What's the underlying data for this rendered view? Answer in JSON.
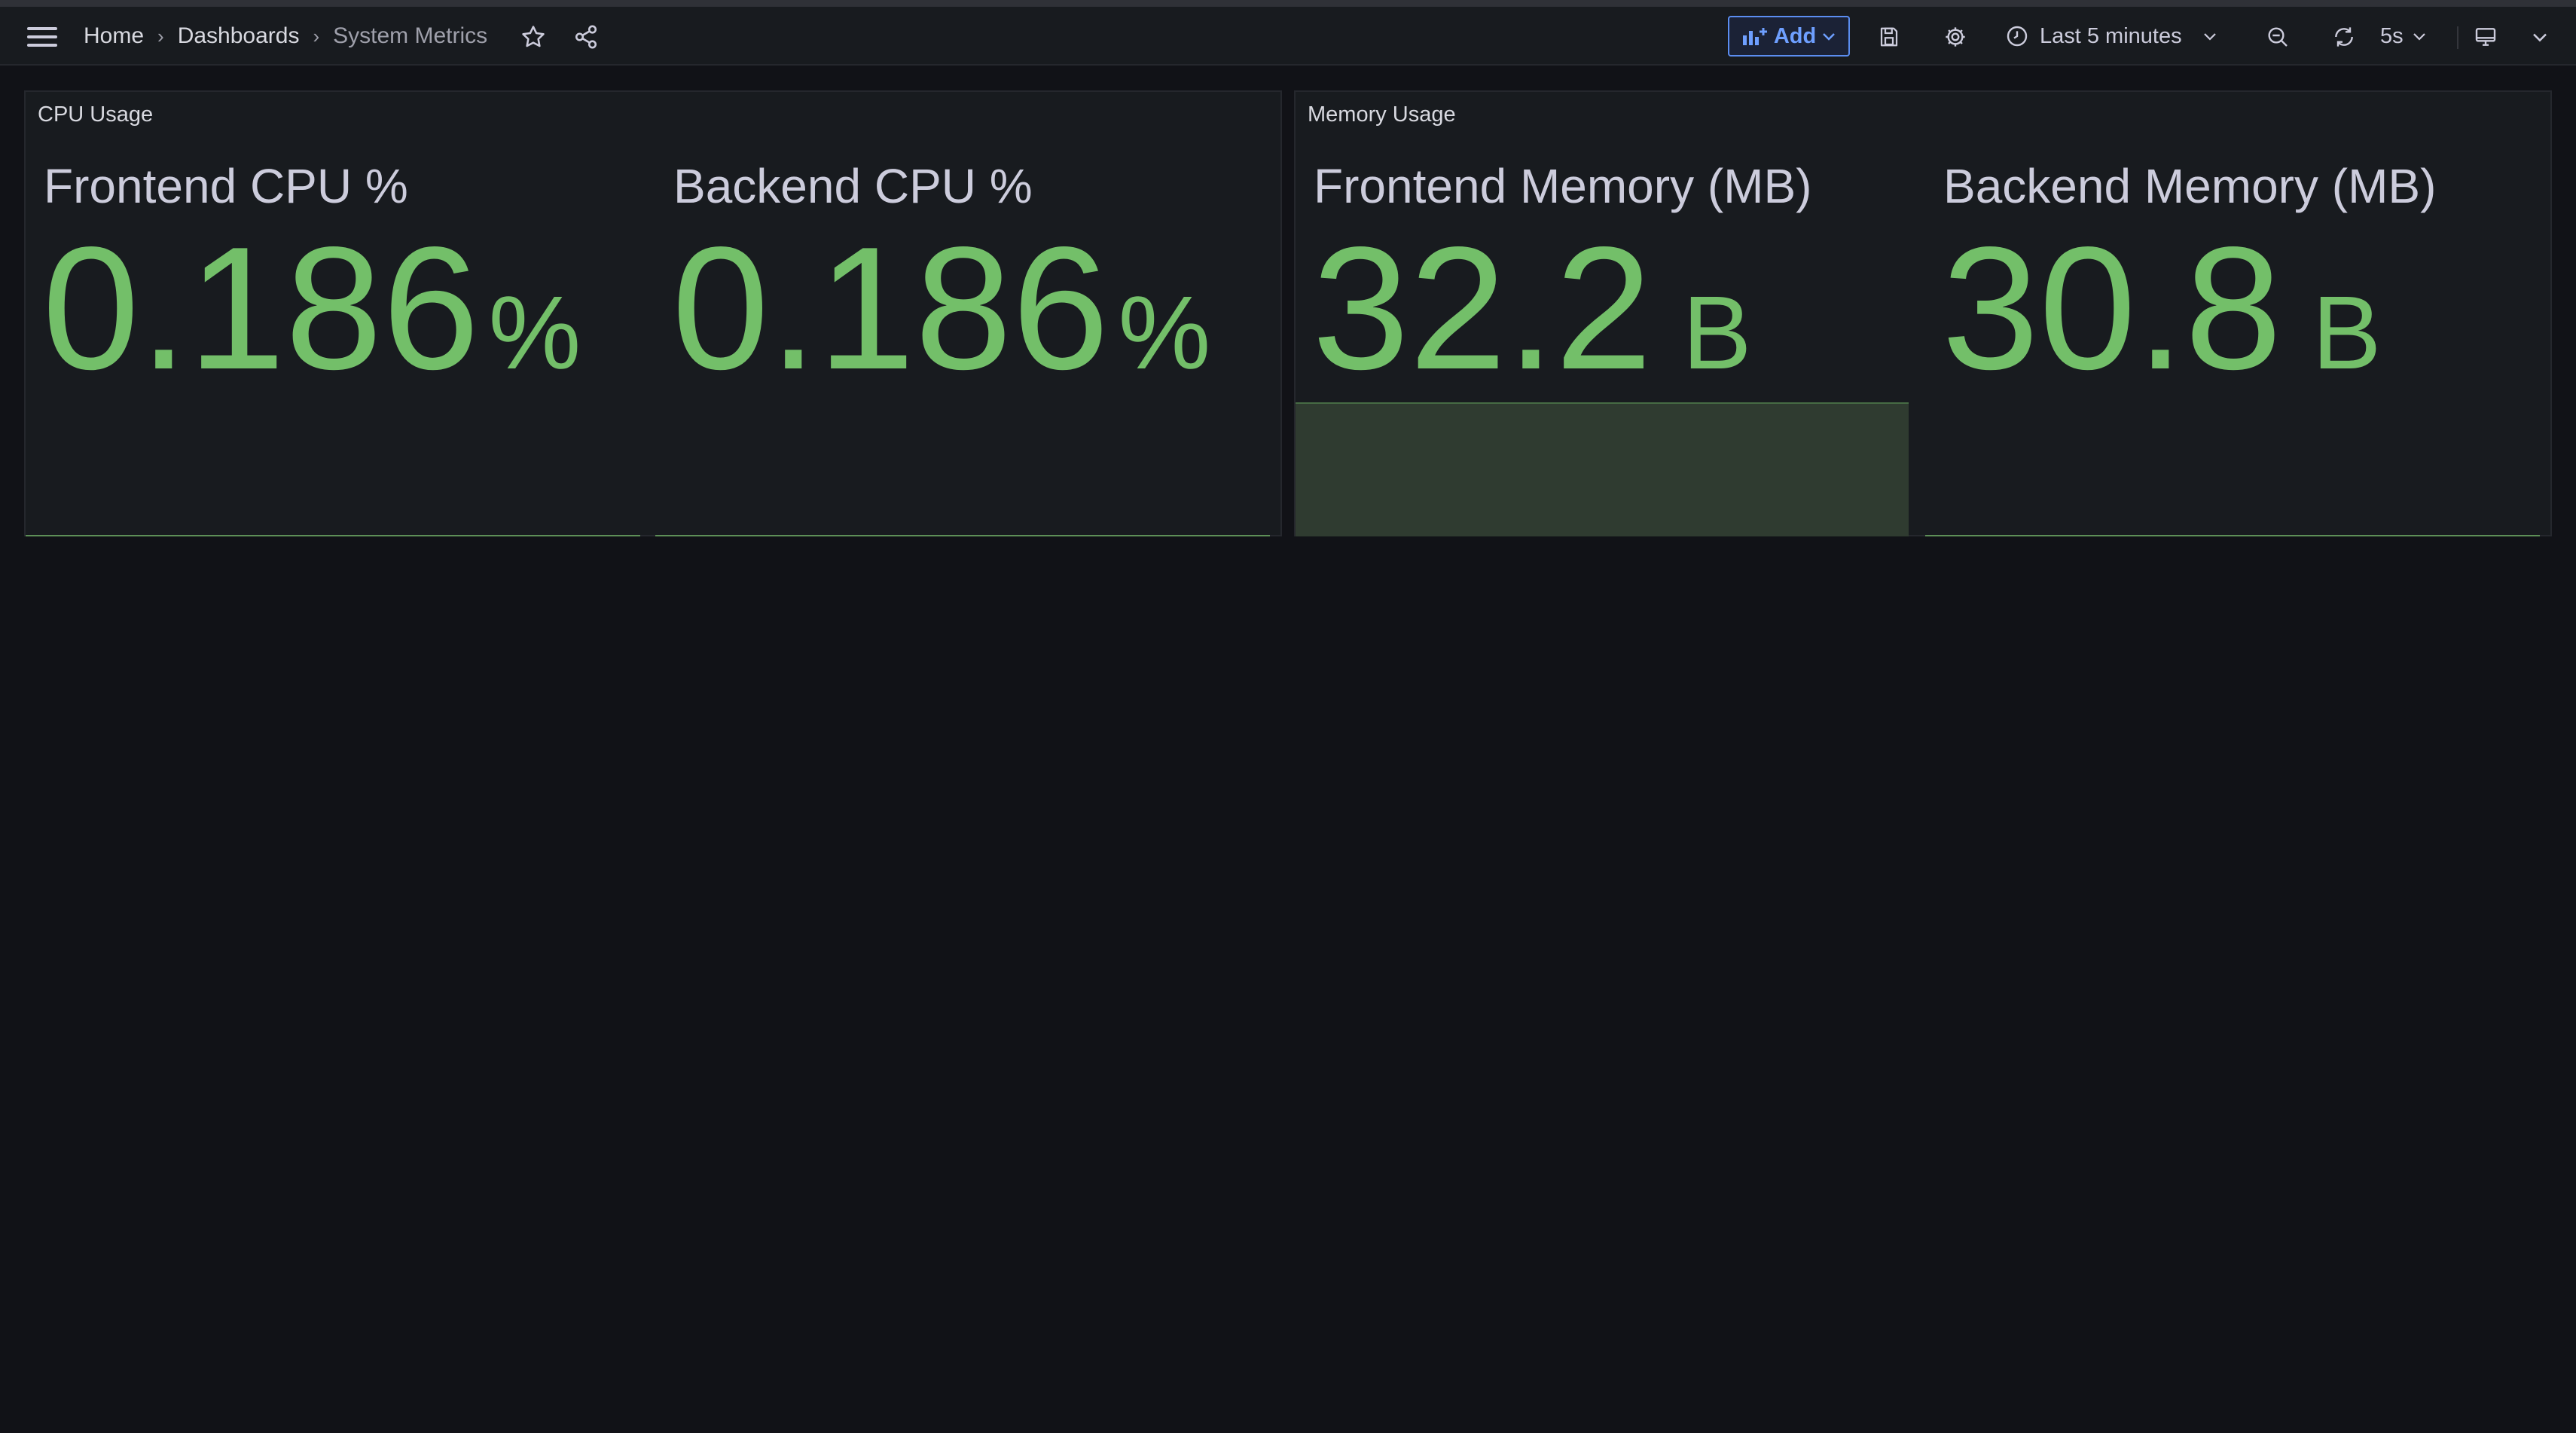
{
  "breadcrumb": {
    "home": "Home",
    "dashboards": "Dashboards",
    "current": "System Metrics"
  },
  "toolbar": {
    "add_label": "Add",
    "time_range": "Last 5 minutes",
    "refresh_interval": "5s"
  },
  "colors": {
    "value_green": "#73bf69",
    "accent_blue": "#6e9fff",
    "background": "#111217",
    "panel": "#181b1f"
  },
  "icons": [
    "hamburger-icon",
    "star-icon",
    "share-icon",
    "chart-add-icon",
    "save-icon",
    "gear-icon",
    "clock-icon",
    "zoom-out-icon",
    "refresh-icon",
    "tv-icon",
    "chevron-down-icon"
  ],
  "panels": [
    {
      "title": "CPU Usage",
      "stats": [
        {
          "label": "Frontend CPU %",
          "value": "0.186",
          "unit": "%"
        },
        {
          "label": "Backend CPU %",
          "value": "0.186",
          "unit": "%"
        }
      ]
    },
    {
      "title": "Memory Usage",
      "stats": [
        {
          "label": "Frontend Memory (MB)",
          "value": "32.2",
          "unit": "B"
        },
        {
          "label": "Backend Memory (MB)",
          "value": "30.8",
          "unit": "B"
        }
      ]
    }
  ]
}
